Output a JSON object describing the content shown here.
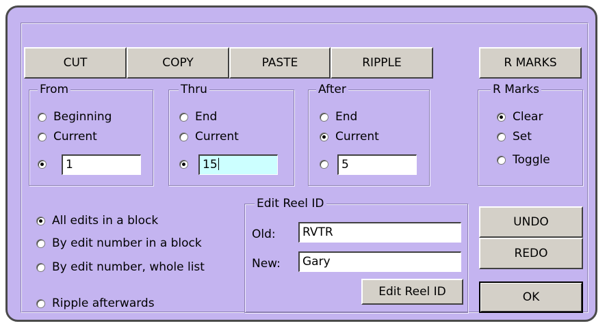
{
  "toolbar": {
    "cut": "CUT",
    "copy": "COPY",
    "paste": "PASTE",
    "ripple": "RIPPLE",
    "r_marks": "R MARKS"
  },
  "from": {
    "title": "From",
    "beginning": "Beginning",
    "current": "Current",
    "value": "1",
    "selected": "value"
  },
  "thru": {
    "title": "Thru",
    "end": "End",
    "current": "Current",
    "value": "15",
    "selected": "value"
  },
  "after": {
    "title": "After",
    "end": "End",
    "current": "Current",
    "value": "5",
    "selected": "current"
  },
  "rmarks": {
    "title": "R Marks",
    "clear": "Clear",
    "set": "Set",
    "toggle": "Toggle",
    "selected": "clear"
  },
  "mode": {
    "all_edits": "All edits in a block",
    "by_edit_block": "By edit number in a block",
    "by_edit_list": "By edit number, whole list",
    "ripple_afterwards": "Ripple afterwards",
    "selected": "all_edits"
  },
  "edit_reel": {
    "title": "Edit Reel ID",
    "old_label": "Old:",
    "old_value": "RVTR",
    "new_label": "New:",
    "new_value": "Gary",
    "button": "Edit Reel ID"
  },
  "actions": {
    "undo": "UNDO",
    "redo": "REDO",
    "ok": "OK"
  },
  "colors": {
    "dialog_bg": "#c4b4f0",
    "button_face": "#d4d0c8",
    "focused_field": "#ccffff"
  }
}
